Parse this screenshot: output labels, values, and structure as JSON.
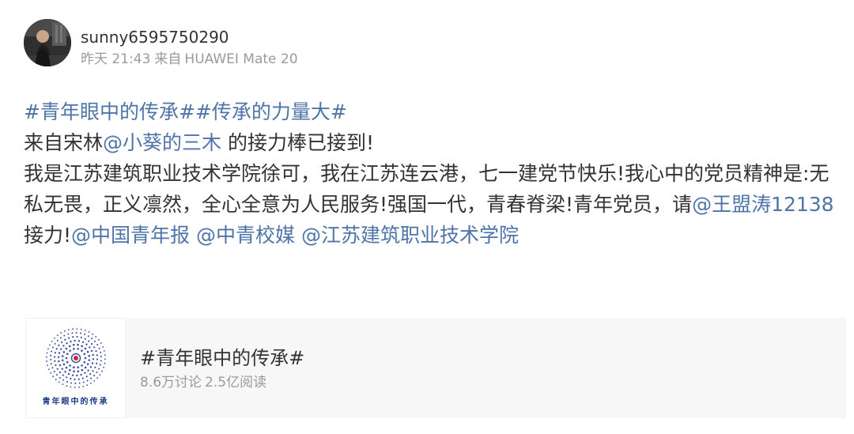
{
  "post": {
    "author": {
      "username": "sunny6595750290",
      "time": "昨天 21:43",
      "source_prefix": "来自",
      "device": "HUAWEI Mate 20"
    },
    "content": {
      "hashtag1": "#青年眼中的传承#",
      "hashtag2": "#传承的力量大#",
      "line2_prefix": "来自宋林",
      "mention_xiaokui": "@小葵的三木",
      "line2_suffix": " 的接力棒已接到!",
      "paragraph": "我是江苏建筑职业技术学院徐可，我在江苏连云港，七一建党节快乐!我心中的党员精神是:无私无畏，正义凛然，全心全意为人民服务!强国一代，青春脊梁!青年党员，请",
      "mention_wang": "@王盟涛12138",
      "relay_text": " 接力!",
      "mention_cyd": "@中国青年报",
      "mention_zqxm": "@中青校媒",
      "mention_jszy": "@江苏建筑职业技术学院"
    },
    "topic_card": {
      "title": "#青年眼中的传承#",
      "discussions": "8.6万讨论",
      "reads": "2.5亿阅读",
      "thumbnail_caption": "青年眼中的传承",
      "dot_color": "#3b4fa8",
      "center_color": "#d9262b"
    },
    "colors": {
      "link": "#4e74a8",
      "text": "#333333",
      "muted": "#9a9a9a",
      "card_bg": "#f7f7f7"
    }
  }
}
